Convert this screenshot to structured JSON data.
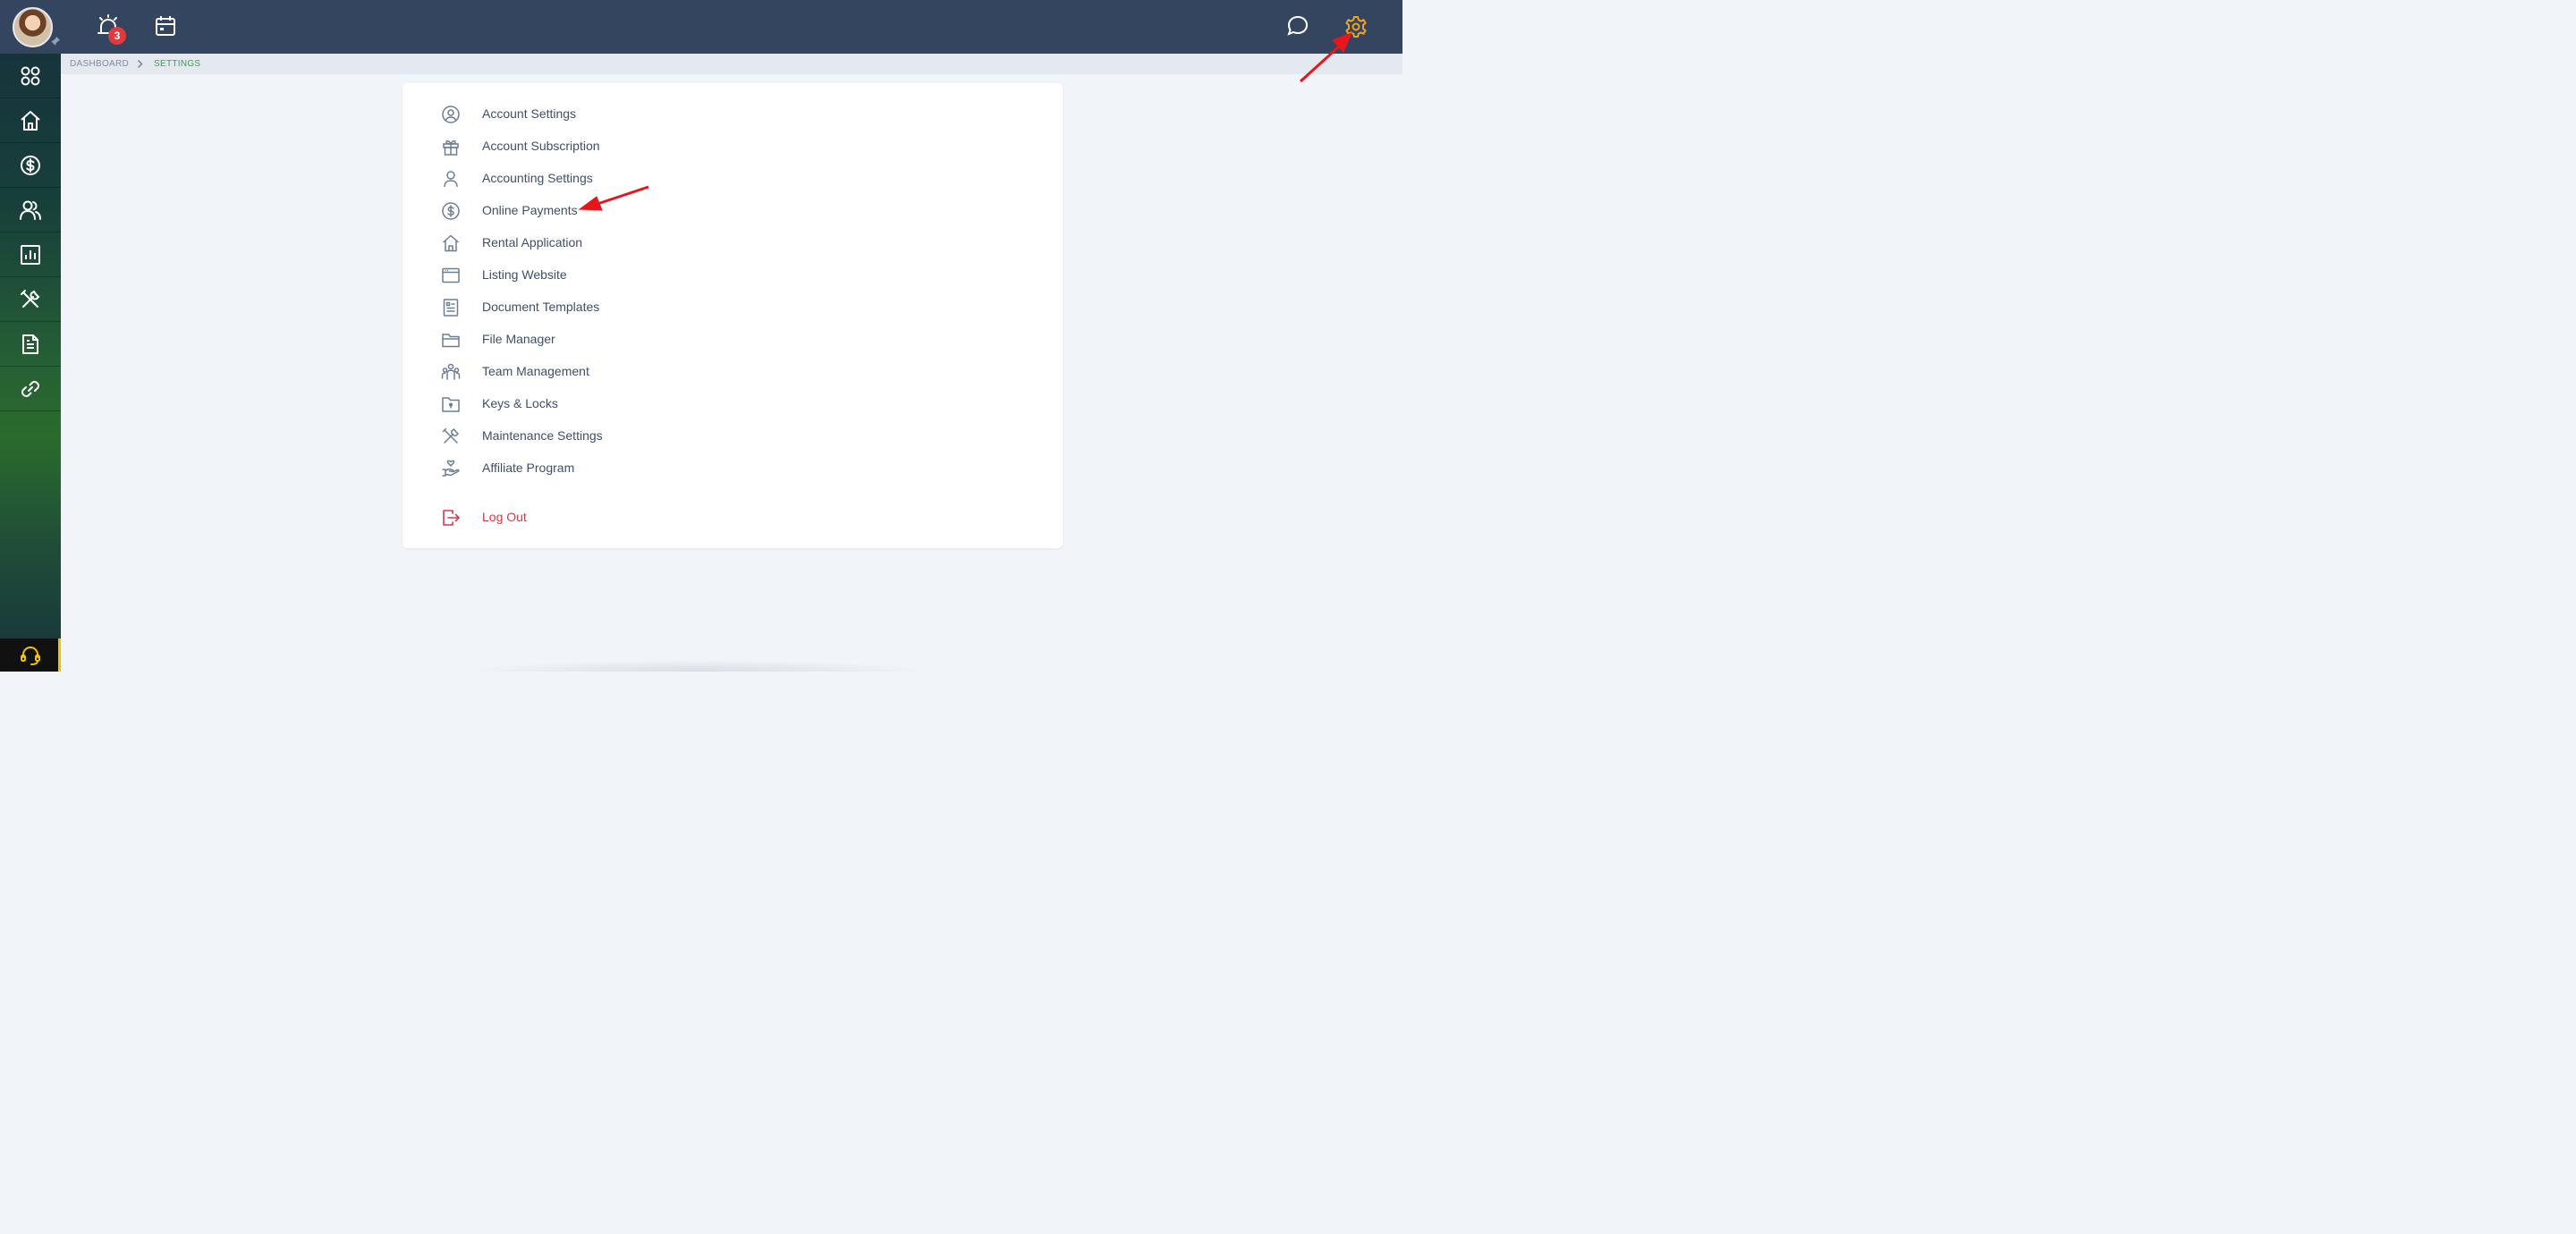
{
  "header": {
    "avatar_icon": "user-avatar",
    "pin_icon": "pin-icon",
    "alarm_icon": "alarm-bell-icon",
    "notification_count": "3",
    "calendar_icon": "calendar-icon",
    "chat_icon": "chat-bubble-icon",
    "settings_icon": "gear-icon",
    "settings_icon_color": "#f0a321",
    "bar_color": "#34455f"
  },
  "sidebar": {
    "items": [
      {
        "icon": "apps-grid-icon"
      },
      {
        "icon": "home-icon"
      },
      {
        "icon": "dollar-circle-icon"
      },
      {
        "icon": "people-icon"
      },
      {
        "icon": "bar-chart-icon"
      },
      {
        "icon": "tools-icon"
      },
      {
        "icon": "document-icon"
      },
      {
        "icon": "link-icon"
      }
    ],
    "support_icon": "headset-icon",
    "support_accent": "#f2c200"
  },
  "breadcrumb": {
    "items": [
      "DASHBOARD",
      "SETTINGS"
    ],
    "active_color": "#3da24a"
  },
  "settings_menu": {
    "items": [
      {
        "label": "Account Settings",
        "icon": "user-circle-icon"
      },
      {
        "label": "Account Subscription",
        "icon": "gift-icon"
      },
      {
        "label": "Accounting Settings",
        "icon": "user-icon"
      },
      {
        "label": "Online Payments",
        "icon": "dollar-circle-icon"
      },
      {
        "label": "Rental Application",
        "icon": "house-icon"
      },
      {
        "label": "Listing Website",
        "icon": "browser-window-icon"
      },
      {
        "label": "Document Templates",
        "icon": "document-list-icon"
      },
      {
        "label": "File Manager",
        "icon": "folder-icon"
      },
      {
        "label": "Team Management",
        "icon": "team-icon"
      },
      {
        "label": "Keys & Locks",
        "icon": "key-folder-icon"
      },
      {
        "label": "Maintenance Settings",
        "icon": "tools-icon"
      },
      {
        "label": "Affiliate Program",
        "icon": "hand-heart-icon"
      }
    ],
    "logout": {
      "label": "Log Out",
      "icon": "logout-icon",
      "color": "#d6394a"
    }
  },
  "annotations": {
    "arrow_color": "#e8161b",
    "targets": [
      "settings-gear",
      "online-payments"
    ]
  }
}
